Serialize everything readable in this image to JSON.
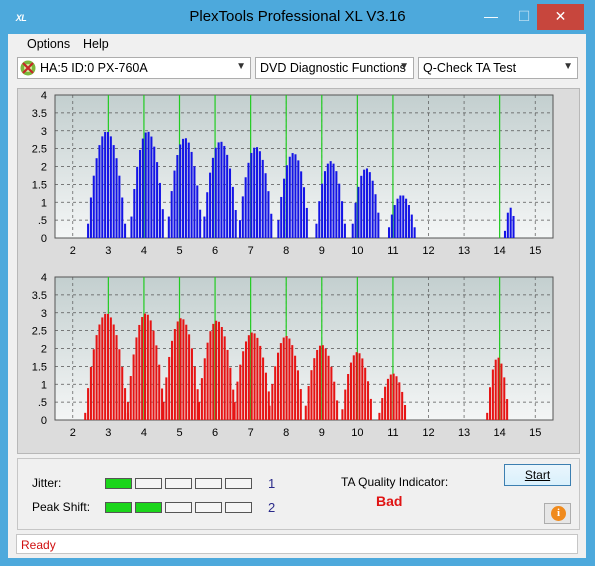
{
  "window": {
    "title": "PlexTools Professional XL V3.16",
    "icon_label": "XL",
    "minimize_glyph": "—",
    "maximize_glyph": "☐",
    "close_glyph": "✕"
  },
  "menu": {
    "options_label": "Options",
    "help_label": "Help"
  },
  "toolbar": {
    "drive_select": "HA:5 ID:0  PX-760A",
    "function_select": "DVD Diagnostic Functions",
    "test_select": "Q-Check TA Test",
    "arrow_glyph": "▼"
  },
  "colors": {
    "plot_bg_top": "#c3cfcf",
    "plot_bg_bottom": "#f4f6f6",
    "top_bars": "#1414e6",
    "bottom_bars": "#e61414",
    "marker_lines": "#22cc22",
    "grid": "#555555",
    "meter_on": "#1bd51b",
    "quality_bad": "#e01414",
    "status_text": "#d01010"
  },
  "chart_data": [
    {
      "type": "bar",
      "title": "",
      "xlim": [
        1.5,
        15.5
      ],
      "ylim": [
        0,
        4
      ],
      "x_ticks": [
        2,
        3,
        4,
        5,
        6,
        7,
        8,
        9,
        10,
        11,
        12,
        13,
        14,
        15
      ],
      "y_ticks": [
        0,
        0.5,
        1,
        1.5,
        2,
        2.5,
        3,
        3.5,
        4
      ],
      "y_tick_labels": [
        "0",
        ".5",
        "1",
        "1.5",
        "2",
        "2.5",
        "3",
        "3.5",
        "4"
      ],
      "marker_lines_x": [
        3,
        4,
        5,
        6,
        7,
        8,
        9,
        10,
        11,
        14
      ],
      "grid": true,
      "peaks": [
        {
          "center": 2.95,
          "halfwidth": 0.52,
          "peak": 2.98,
          "edge": 0.4
        },
        {
          "center": 4.1,
          "halfwidth": 0.45,
          "peak": 2.98,
          "edge": 0.6
        },
        {
          "center": 5.15,
          "halfwidth": 0.45,
          "peak": 2.8,
          "edge": 0.6
        },
        {
          "center": 6.15,
          "halfwidth": 0.45,
          "peak": 2.7,
          "edge": 0.6
        },
        {
          "center": 7.15,
          "halfwidth": 0.45,
          "peak": 2.55,
          "edge": 0.5
        },
        {
          "center": 8.2,
          "halfwidth": 0.42,
          "peak": 2.38,
          "edge": 0.5
        },
        {
          "center": 9.25,
          "halfwidth": 0.4,
          "peak": 2.15,
          "edge": 0.4
        },
        {
          "center": 10.25,
          "halfwidth": 0.38,
          "peak": 1.95,
          "edge": 0.4
        },
        {
          "center": 11.25,
          "halfwidth": 0.36,
          "peak": 1.2,
          "edge": 0.3
        },
        {
          "center": 14.3,
          "halfwidth": 0.15,
          "peak": 0.85,
          "edge": 0.2
        }
      ]
    },
    {
      "type": "bar",
      "title": "",
      "xlim": [
        1.5,
        15.5
      ],
      "ylim": [
        0,
        4
      ],
      "x_ticks": [
        2,
        3,
        4,
        5,
        6,
        7,
        8,
        9,
        10,
        11,
        12,
        13,
        14,
        15
      ],
      "y_ticks": [
        0,
        0.5,
        1,
        1.5,
        2,
        2.5,
        3,
        3.5,
        4
      ],
      "y_tick_labels": [
        "0",
        ".5",
        "1",
        "1.5",
        "2",
        "2.5",
        "3",
        "3.5",
        "4"
      ],
      "marker_lines_x": [
        3,
        4,
        5,
        6,
        7,
        8,
        9,
        10,
        11,
        14
      ],
      "grid": true,
      "peaks": [
        {
          "center": 2.95,
          "halfwidth": 0.6,
          "peak": 2.98,
          "edge": 0.2
        },
        {
          "center": 4.05,
          "halfwidth": 0.5,
          "peak": 2.98,
          "edge": 0.5
        },
        {
          "center": 5.05,
          "halfwidth": 0.5,
          "peak": 2.85,
          "edge": 0.5
        },
        {
          "center": 6.05,
          "halfwidth": 0.5,
          "peak": 2.78,
          "edge": 0.5
        },
        {
          "center": 7.05,
          "halfwidth": 0.5,
          "peak": 2.45,
          "edge": 0.5
        },
        {
          "center": 8.0,
          "halfwidth": 0.47,
          "peak": 2.35,
          "edge": 0.4
        },
        {
          "center": 9.0,
          "halfwidth": 0.45,
          "peak": 2.1,
          "edge": 0.4
        },
        {
          "center": 10.0,
          "halfwidth": 0.42,
          "peak": 1.9,
          "edge": 0.3
        },
        {
          "center": 11.0,
          "halfwidth": 0.38,
          "peak": 1.3,
          "edge": 0.2
        },
        {
          "center": 13.95,
          "halfwidth": 0.3,
          "peak": 1.75,
          "edge": 0.2
        }
      ]
    }
  ],
  "results": {
    "jitter_label": "Jitter:",
    "jitter_value": "1",
    "jitter_level": 1,
    "peak_shift_label": "Peak Shift:",
    "peak_shift_value": "2",
    "peak_shift_level": 2,
    "meter_segments": 5,
    "ta_quality_label": "TA Quality Indicator:",
    "ta_quality_value": "Bad",
    "start_label": "Start",
    "info_glyph": "i"
  },
  "status": {
    "text": "Ready"
  }
}
